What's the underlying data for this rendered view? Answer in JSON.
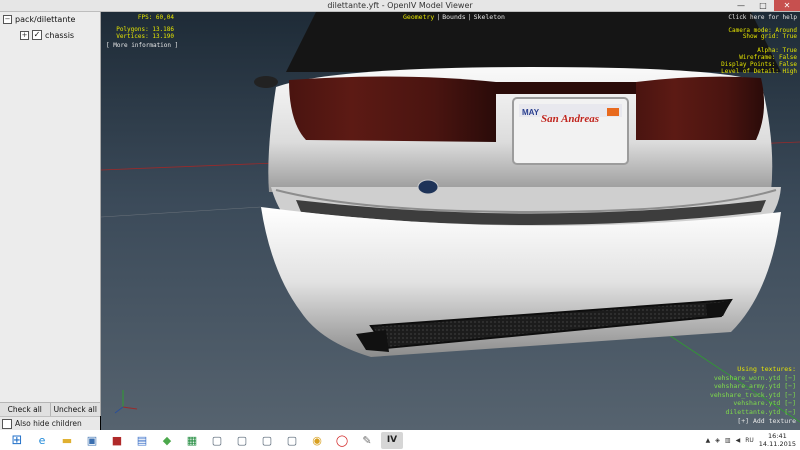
{
  "window": {
    "title": "dilettante.yft - OpenIV Model Viewer",
    "minimize": "—",
    "maximize": "□",
    "close": "✕"
  },
  "tree": {
    "root_label": "pack/dilettante",
    "root_expander": "−",
    "child_label": "chassis",
    "child_expander": "+",
    "child_checked": "✓"
  },
  "buttons": {
    "check_all": "Check all",
    "uncheck_all": "Uncheck all",
    "hide_children": "Also hide children"
  },
  "viewer": {
    "tabs": [
      "Geometry",
      "Bounds",
      "Skeleton"
    ],
    "active_tab": "Geometry",
    "stats": {
      "fps": "FPS: 60,04",
      "polygons": "Polygons: 13.186",
      "vertices": "Vertices: 13.190",
      "more_info": "[ More information ]"
    },
    "help": "Click here for help",
    "settings": {
      "camera_mode": "Camera mode: Around",
      "show_grid": "Show grid: True",
      "alpha": "Alpha: True",
      "wireframe": "Wireframe: False",
      "display_points": "Display Points: False",
      "lod": "Level of Detail: High"
    },
    "textures": {
      "heading": "Using textures:",
      "items": [
        "vehshare_worn.ytd [−]",
        "vehshare_army.ytd [−]",
        "vehshare_truck.ytd [−]",
        "vehshare.ytd [−]",
        "dilettante.ytd [−]"
      ],
      "add": "[+] Add texture"
    },
    "plate": {
      "top": "MAY",
      "text": "San Andreas"
    }
  },
  "taskbar": {
    "start_icon": "windows-start-icon",
    "apps": [
      "ie-icon",
      "explorer-icon",
      "remote-desktop-icon",
      "app-red-icon",
      "app-blue-icon",
      "app-green-icon",
      "excel-icon",
      "app-window-icon",
      "app-window-icon-2",
      "app-window-icon-3",
      "app-window-icon-4",
      "chrome-icon",
      "opera-icon",
      "app-tool-icon",
      "openiv-icon"
    ],
    "time": "16:41",
    "date": "14.11.2015",
    "language": "RU"
  },
  "colors": {
    "accent_yellow": "#e6e600",
    "texture_green": "#7fdc4a",
    "close_red": "#c7504f"
  }
}
